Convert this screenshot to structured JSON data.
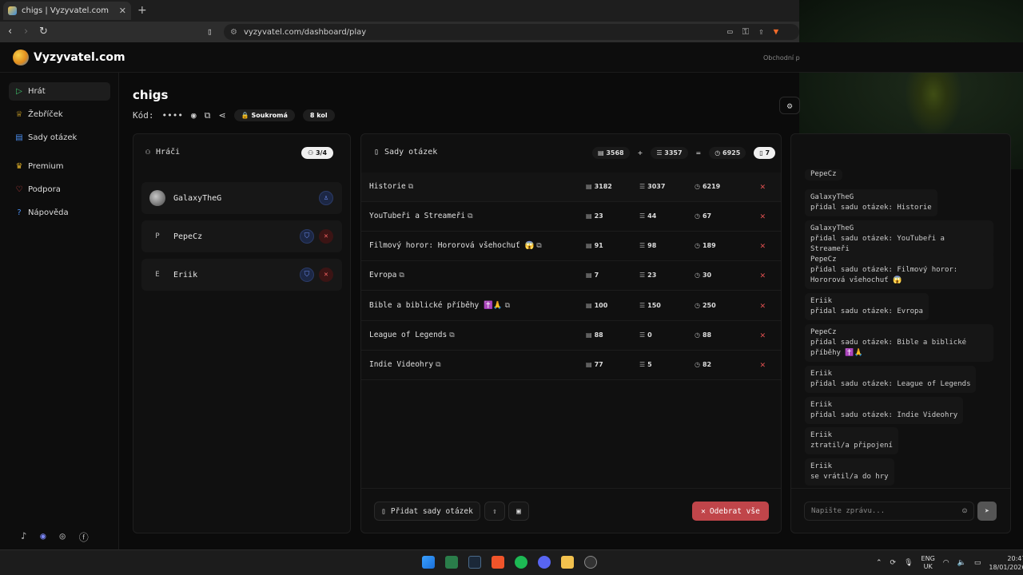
{
  "browser": {
    "tab_title": "chigs | Vyzyvatel.com",
    "tab_close": "✕",
    "new_tab": "+",
    "url": "vyzyvatel.com/dashboard/play"
  },
  "header": {
    "logo_text": "Vyzyvatel.com",
    "business_link": "Obchodní p"
  },
  "sidebar": {
    "items": [
      {
        "label": "Hrát",
        "icon": "play-icon",
        "active": true
      },
      {
        "label": "Žebříček",
        "icon": "trophy-icon"
      },
      {
        "label": "Sady otázek",
        "icon": "book-icon"
      },
      {
        "label": "Premium",
        "icon": "crown-icon"
      },
      {
        "label": "Podpora",
        "icon": "heart-icon"
      },
      {
        "label": "Nápověda",
        "icon": "help-icon"
      }
    ]
  },
  "game": {
    "title": "chigs",
    "code_label": "Kód:",
    "code_masked": "••••",
    "privacy": "Soukromá",
    "rounds": "8 kol"
  },
  "players_panel": {
    "title": "Hráči",
    "count": "3/4",
    "players": [
      {
        "name": "GalaxyTheG",
        "avatar": "",
        "role": "host"
      },
      {
        "name": "PepeCz",
        "avatar": "P",
        "role": "player"
      },
      {
        "name": "Eriik",
        "avatar": "E",
        "role": "player"
      }
    ]
  },
  "sets_panel": {
    "title": "Sady otázek",
    "totals": {
      "a": "3568",
      "plus": "+",
      "b": "3357",
      "eq": "=",
      "sum": "6925",
      "count": "7"
    },
    "sets": [
      {
        "name": "Historie",
        "a": "3182",
        "b": "3037",
        "sum": "6219"
      },
      {
        "name": "YouTubeři a Streameři",
        "a": "23",
        "b": "44",
        "sum": "67"
      },
      {
        "name": "Filmový horor: Hororová všehochuť 😱",
        "a": "91",
        "b": "98",
        "sum": "189"
      },
      {
        "name": "Evropa",
        "a": "7",
        "b": "23",
        "sum": "30"
      },
      {
        "name": "Bible a biblické příběhy ✝️🙏",
        "a": "100",
        "b": "150",
        "sum": "250"
      },
      {
        "name": "League of Legends",
        "a": "88",
        "b": "0",
        "sum": "88"
      },
      {
        "name": "Indie Videohry",
        "a": "77",
        "b": "5",
        "sum": "82"
      }
    ],
    "add_button": "Přidat sady otázek",
    "remove_all_button": "Odebrat vše"
  },
  "chat": {
    "messages": [
      {
        "user": "PepeCz",
        "text": ""
      },
      {
        "user": "GalaxyTheG",
        "text": "přidal sadu otázek: Historie"
      },
      {
        "user": "GalaxyTheG",
        "text": "přidal sadu otázek: YouTubeři a Streameři"
      },
      {
        "user": "PepeCz",
        "text": "přidal sadu otázek: Filmový horor: Hororová všehochuť 😱"
      },
      {
        "user": "Eriik",
        "text": "přidal sadu otázek: Evropa"
      },
      {
        "user": "PepeCz",
        "text": "přidal sadu otázek: Bible a biblické příběhy ✝️🙏"
      },
      {
        "user": "Eriik",
        "text": "přidal sadu otázek: League of Legends"
      },
      {
        "user": "Eriik",
        "text": "přidal sadu otázek: Indie Videohry"
      },
      {
        "user": "Eriik",
        "text": "ztratil/a připojení"
      },
      {
        "user": "Eriik",
        "text": "se vrátil/a do hry"
      }
    ],
    "input_placeholder": "Napište zprávu..."
  },
  "taskbar": {
    "lang_1": "ENG",
    "lang_2": "UK",
    "time": "20:47",
    "date": "18/01/2026"
  },
  "colors": {
    "accent_red": "#c0454a",
    "accent_blue": "#6d8cf0",
    "active_green": "#3ec46d"
  }
}
